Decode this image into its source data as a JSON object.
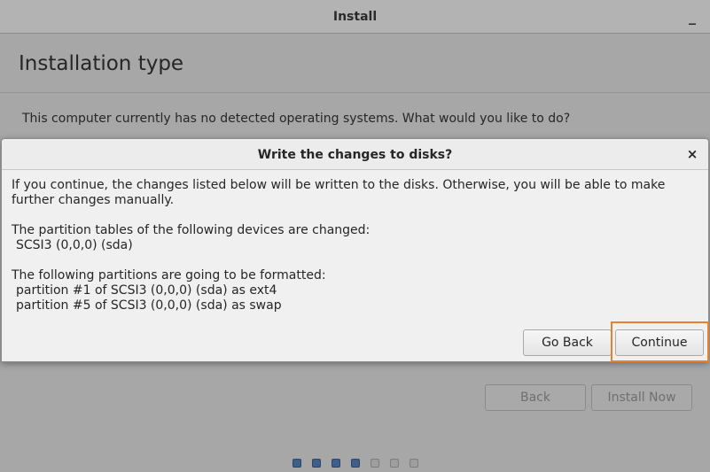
{
  "window": {
    "title": "Install",
    "minimize_label": "_"
  },
  "page": {
    "title": "Installation type",
    "question": "This computer currently has no detected operating systems. What would you like to do?"
  },
  "navigation": {
    "back_label": "Back",
    "install_now_label": "Install Now"
  },
  "progress": {
    "total_steps": 7,
    "completed_steps": 4
  },
  "dialog": {
    "title": "Write the changes to disks?",
    "close_label": "×",
    "intro": "If you continue, the changes listed below will be written to the disks. Otherwise, you will be able to make further changes manually.",
    "partition_tables_heading": "The partition tables of the following devices are changed:",
    "partition_tables": [
      "SCSI3 (0,0,0) (sda)"
    ],
    "formatted_heading": "The following partitions are going to be formatted:",
    "formatted_partitions": [
      "partition #1 of SCSI3 (0,0,0) (sda) as ext4",
      "partition #5 of SCSI3 (0,0,0) (sda) as swap"
    ],
    "go_back_label": "Go Back",
    "continue_label": "Continue"
  },
  "colors": {
    "highlight": "#e8812e",
    "progress_filled": "#3f5f8a"
  }
}
